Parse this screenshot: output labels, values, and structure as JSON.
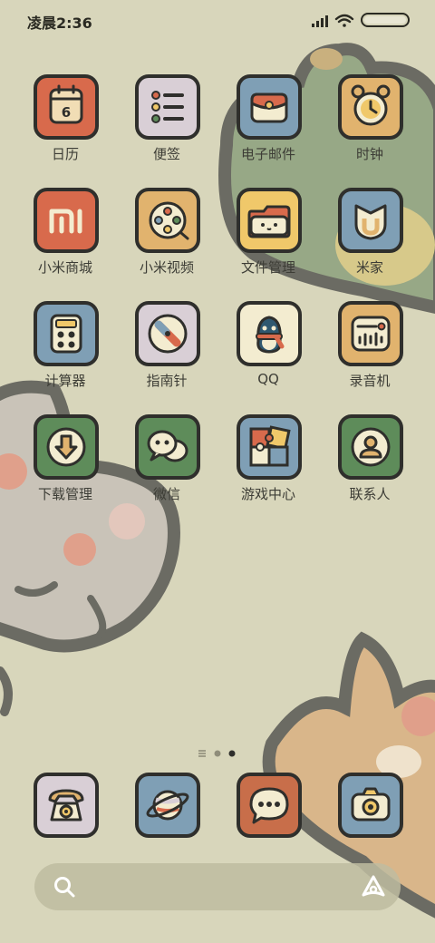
{
  "status_bar": {
    "time": "凌晨2:36",
    "battery_level": 1.0
  },
  "apps": [
    {
      "label": "日历",
      "icon": "calendar-icon",
      "tile_color": "#d86a4c",
      "badge_text": "6"
    },
    {
      "label": "便签",
      "icon": "notes-icon",
      "tile_color": "#d9cfd6"
    },
    {
      "label": "电子邮件",
      "icon": "email-icon",
      "tile_color": "#7f9fb5"
    },
    {
      "label": "时钟",
      "icon": "clock-icon",
      "tile_color": "#e1b36e"
    },
    {
      "label": "小米商城",
      "icon": "mi-store-icon",
      "tile_color": "#d86a4c",
      "badge_text": "mi"
    },
    {
      "label": "小米视频",
      "icon": "video-icon",
      "tile_color": "#e1b36e"
    },
    {
      "label": "文件管理",
      "icon": "folder-icon",
      "tile_color": "#f0c86a"
    },
    {
      "label": "米家",
      "icon": "mijia-icon",
      "tile_color": "#7f9fb5"
    },
    {
      "label": "计算器",
      "icon": "calculator-icon",
      "tile_color": "#7f9fb5"
    },
    {
      "label": "指南针",
      "icon": "compass-icon",
      "tile_color": "#d9cfd6"
    },
    {
      "label": "QQ",
      "icon": "qq-penguin-icon",
      "tile_color": "#f3ecd0"
    },
    {
      "label": "录音机",
      "icon": "recorder-icon",
      "tile_color": "#e1b36e"
    },
    {
      "label": "下载管理",
      "icon": "download-icon",
      "tile_color": "#5e8c5a"
    },
    {
      "label": "微信",
      "icon": "wechat-icon",
      "tile_color": "#5e8c5a"
    },
    {
      "label": "游戏中心",
      "icon": "puzzle-icon",
      "tile_color": "#7f9fb5"
    },
    {
      "label": "联系人",
      "icon": "contacts-icon",
      "tile_color": "#5e8c5a"
    }
  ],
  "dock": [
    {
      "icon": "phone-icon",
      "tile_color": "#d9cfd6"
    },
    {
      "icon": "browser-planet-icon",
      "tile_color": "#7f9fb5"
    },
    {
      "icon": "messages-icon",
      "tile_color": "#c86e4a"
    },
    {
      "icon": "camera-icon",
      "tile_color": "#7f9fb5"
    }
  ],
  "page_indicator": {
    "pages": 3,
    "current_page": 3
  },
  "colors": {
    "background": "#d8d6bb",
    "outline": "#2f2f2c",
    "label_text": "#3d3d36",
    "red": "#d86a4c",
    "orange": "#e1b36e",
    "blue": "#7f9fb5",
    "green": "#5e8c5a",
    "lilac": "#d9cfd6",
    "cream": "#f3ecd0"
  }
}
